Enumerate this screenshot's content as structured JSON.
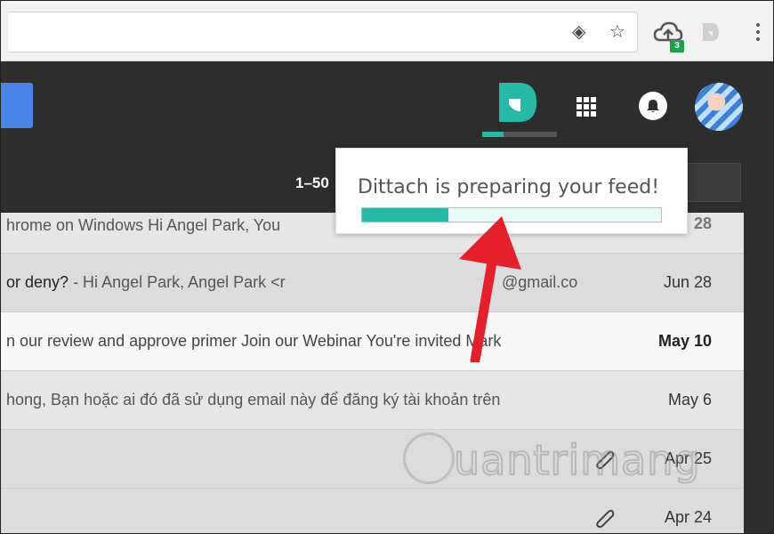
{
  "browser": {
    "extension_badge": "3"
  },
  "toolbar": {
    "pagination": "1–50"
  },
  "popup": {
    "message": "Dittach is preparing your feed!",
    "progress": 0.29
  },
  "dittach_header_progress": 0.28,
  "emails": [
    {
      "snippet": "hrome on Windows Hi Angel Park, You",
      "date": "28",
      "style": "first"
    },
    {
      "subject": "or deny?",
      "snippet": " - Hi Angel Park, Angel Park <r",
      "email_fragment": "@gmail.co",
      "date": "Jun 28",
      "style": "read"
    },
    {
      "snippet": "n our review and approve primer Join our Webinar You're invited Mark",
      "date": "May 10",
      "style": "unread-bold"
    },
    {
      "snippet": "hong, Bạn hoặc ai đó đã sử dụng email này để đăng ký tài khoản trên",
      "date": "May 6",
      "style": "read"
    },
    {
      "snippet": "",
      "date": "Apr 25",
      "attachment": true,
      "style": "read-dark"
    },
    {
      "snippet": "",
      "date": "Apr 24",
      "attachment": true,
      "style": "read-dark"
    }
  ],
  "watermark": {
    "text": "uantrimang"
  },
  "icons": [
    "view-icon",
    "star-icon",
    "cloud-upload-icon",
    "dittach-extension-icon",
    "menu-icon",
    "dittach-icon",
    "apps-icon",
    "notifications-icon",
    "avatar",
    "attachment-icon"
  ],
  "colors": {
    "accent": "#26b9a8",
    "header": "#2d2d2d",
    "arrow": "#e5202a",
    "compose_blue": "#4a86e8"
  }
}
